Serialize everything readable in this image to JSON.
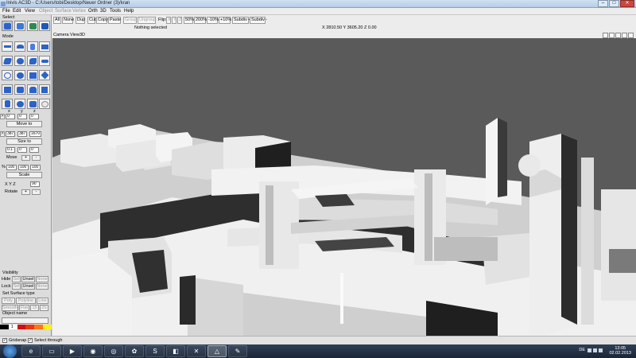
{
  "window": {
    "title": "Inivis AC3D - C:/Users/tobi/Desktop/Neuer Ordner (3)/kran"
  },
  "menu": [
    {
      "label": "File",
      "enabled": true
    },
    {
      "label": "Edit",
      "enabled": true
    },
    {
      "label": "View",
      "enabled": true
    },
    {
      "label": "Object",
      "enabled": false
    },
    {
      "label": "Surface",
      "enabled": false
    },
    {
      "label": "Vertex",
      "enabled": false
    },
    {
      "label": "Orth",
      "enabled": true
    },
    {
      "label": "3D",
      "enabled": true
    },
    {
      "label": "Tools",
      "enabled": true
    },
    {
      "label": "Help",
      "enabled": true
    }
  ],
  "toolbar": {
    "all": "All",
    "none": "None",
    "dup": "Dup",
    "cut": "Cut",
    "copy": "Copy",
    "paste": "Paste",
    "group": "Group",
    "ungroup": "Ungroup",
    "flip_label": "Flip:",
    "flip_x": "X",
    "flip_y": "Y",
    "flip_z": "Z",
    "zoom_50": "50%",
    "zoom_200": "200%",
    "zoom_minus10": "-10%",
    "zoom_plus10": "+10%",
    "subdiv_plus": "Subdiv +",
    "subdiv_minus": "Subdiv -",
    "status": "Nothing selected",
    "coords": "X 2810.50 Y 3605.20 Z 0.00"
  },
  "left": {
    "select_label": "Select",
    "mode_label": "Mode",
    "axis_x": "x",
    "axis_y": "y",
    "axis_z": "z",
    "move_to_vals": [
      "0",
      "0",
      "0"
    ],
    "move_to": "Move to",
    "size_vals": [
      "387",
      "387",
      "1670"
    ],
    "size_to": "Size to",
    "move_vals": [
      "0.1",
      "0",
      "0"
    ],
    "move": "Move",
    "scale_pct": "%",
    "scale_vals": [
      "100",
      "100",
      "100"
    ],
    "scale": "Scale",
    "rotate_axes": "X Y Z",
    "rotate_val": "90",
    "rotate": "Rotate",
    "plus": "+",
    "minus": "-",
    "visibility": "Visibility",
    "hide": "Hide",
    "lock": "Lock",
    "sel": "Sel",
    "unsel": "Unsel",
    "none": "None",
    "surface_type": "Set Surface type",
    "poly": "Poly",
    "polyline": "Polyline",
    "line": "Line",
    "smooth": "Smooth",
    "flat": "Flat",
    "n15": "15",
    "n2s": "2S",
    "object_name": "Object name",
    "palette_index": "1"
  },
  "palette": [
    "#000000",
    "#ffffff",
    "#cc1111",
    "#ee3311",
    "#ff7711",
    "#ffee11"
  ],
  "view": {
    "camera": "Camera",
    "view": "View",
    "mode": "3D"
  },
  "bottom": {
    "gridsnap": "Gridsnap",
    "select_through": "Select through"
  },
  "taskbar": {
    "apps": [
      "ie-icon",
      "explorer-icon",
      "media-player-icon",
      "firefox-icon",
      "chrome-icon",
      "chat-icon",
      "skype-icon",
      "paint-icon",
      "ac3d-icon",
      "xampp-icon",
      "editor-icon"
    ],
    "lang": "DE",
    "time": "13:05",
    "date": "02.02.2013"
  },
  "colors": {
    "viewport_bg": "#5a5a5a",
    "model_light": "#e8e8e8",
    "model_shadow": "#2a2a2a",
    "accent": "#2d62c6"
  }
}
